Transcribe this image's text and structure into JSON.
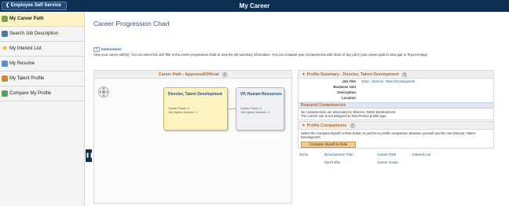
{
  "header": {
    "back_label": "Employee Self Service",
    "title": "My Career"
  },
  "sidebar": {
    "items": [
      {
        "label": "My Career Path",
        "icon": "career-path-icon",
        "color": "#7aa34a",
        "active": true
      },
      {
        "label": "Search Job Description",
        "icon": "search-job-icon",
        "color": "#4a7ea8"
      },
      {
        "label": "My Interest List",
        "icon": "star-icon",
        "color": "#f0b020"
      },
      {
        "label": "My Resume",
        "icon": "resume-icon",
        "color": "#5a8fd0"
      },
      {
        "label": "My Talent Profile",
        "icon": "talent-profile-icon",
        "color": "#d08a3a"
      },
      {
        "label": "Compare My Profile",
        "icon": "compare-icon",
        "color": "#5aa060"
      }
    ]
  },
  "main": {
    "title": "Career Progression Chart",
    "instructions_label": "Instructions",
    "instructions_text": "View your career path(s). You can select the Job Title in the career progression chart to view the job summary information. You can compare your competencies with those of any job in your career path to view gap or fit percentage."
  },
  "career_path": {
    "header": "Career Path - Approved/Official",
    "cards": [
      {
        "title": "Director, Talent Development",
        "line1": "Career Flows: 0",
        "line2": "Job Option Number: 1"
      },
      {
        "title": "VP, Human Resources",
        "line1": "Career Flows: 0",
        "line2": "Job Option Number: 1"
      }
    ]
  },
  "profile_summary": {
    "header": "Profile Summary - Director, Talent Development",
    "rows": [
      {
        "label": "Job Title",
        "value": "3343 - Director, Talent Development"
      },
      {
        "label": "Business Unit",
        "value": ""
      },
      {
        "label": "Description",
        "value": ""
      },
      {
        "label": "Location",
        "value": ""
      }
    ],
    "required_header": "Required Competencies",
    "required_text_1": "No competencies are associated to Director, Talent Development.",
    "required_text_2": "The current role is not assigned to Non-Person profile type."
  },
  "profile_comparisons": {
    "header": "Profile Comparisons",
    "text": "Select the Compare Myself to Role button to perform a profile comparison between yourself and the role Director, Talent Development.",
    "button_label": "Compare Myself to Role"
  },
  "goto": {
    "label": "Go to",
    "links": [
      "Development Plan",
      "Career Path",
      "Interest List",
      "My Profile",
      "Career Goals"
    ]
  }
}
